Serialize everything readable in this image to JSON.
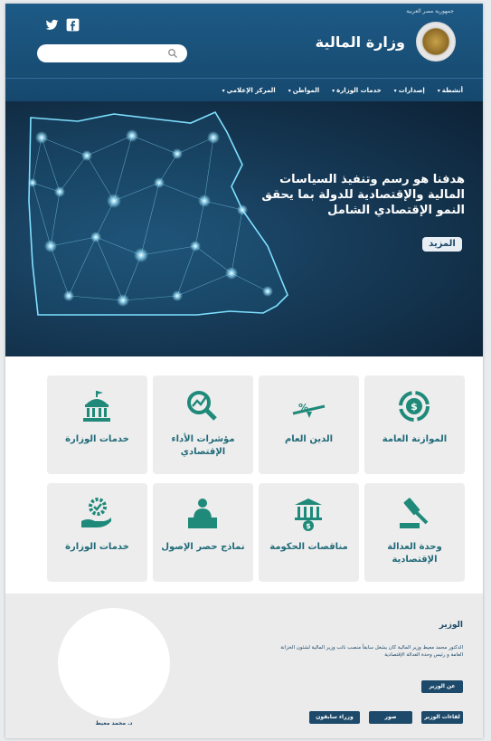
{
  "header": {
    "emblem_caption": "جمهورية مصر العربية",
    "ministry_name": "وزارة المالية",
    "search_placeholder": ""
  },
  "nav": {
    "items": [
      "أنشطة",
      "إصدارات",
      "خدمات الوزارة",
      "المواطن",
      "المركز الإعلامي"
    ]
  },
  "hero": {
    "headline": "هدفنا هو رسم وتنفيذ السياسات المالية والإقتصادية للدولة بما يحقق النمو الإقتصادي الشامل",
    "more_button": "المزيد"
  },
  "cards": [
    {
      "label": "الموازنة العامة",
      "icon": "dollar-cycle-icon"
    },
    {
      "label": "الدين العام",
      "icon": "percent-seesaw-icon"
    },
    {
      "label": "مؤشرات الأداء الإقتصادي",
      "icon": "magnifier-chart-icon"
    },
    {
      "label": "خدمات الوزارة",
      "icon": "government-building-icon"
    },
    {
      "label": "وحدة العدالة الإقتصادية",
      "icon": "gavel-icon"
    },
    {
      "label": "مناقصات الحكومة",
      "icon": "bank-coin-icon"
    },
    {
      "label": "نماذج حصر الإصول",
      "icon": "speaker-podium-icon"
    },
    {
      "label": "خدمات الوزارة",
      "icon": "gear-hand-icon"
    }
  ],
  "minister": {
    "section_title": "الوزير",
    "bio": "الدكتور محمد معيط وزير المالية كان يشغل سابقاً منصب نائب وزير المالية لشئون الخزانة العامة و رئيس وحدة العدالة الإقتصادية",
    "about_button": "عن الوزير",
    "buttons": [
      "لقاءات الوزير",
      "صور",
      "وزراء سابقون"
    ],
    "portrait_caption": "د. محمد معيط"
  },
  "colors": {
    "header_blue": "#1d5a86",
    "card_text": "#1f6a78",
    "dark_blue": "#1d4a6b"
  }
}
